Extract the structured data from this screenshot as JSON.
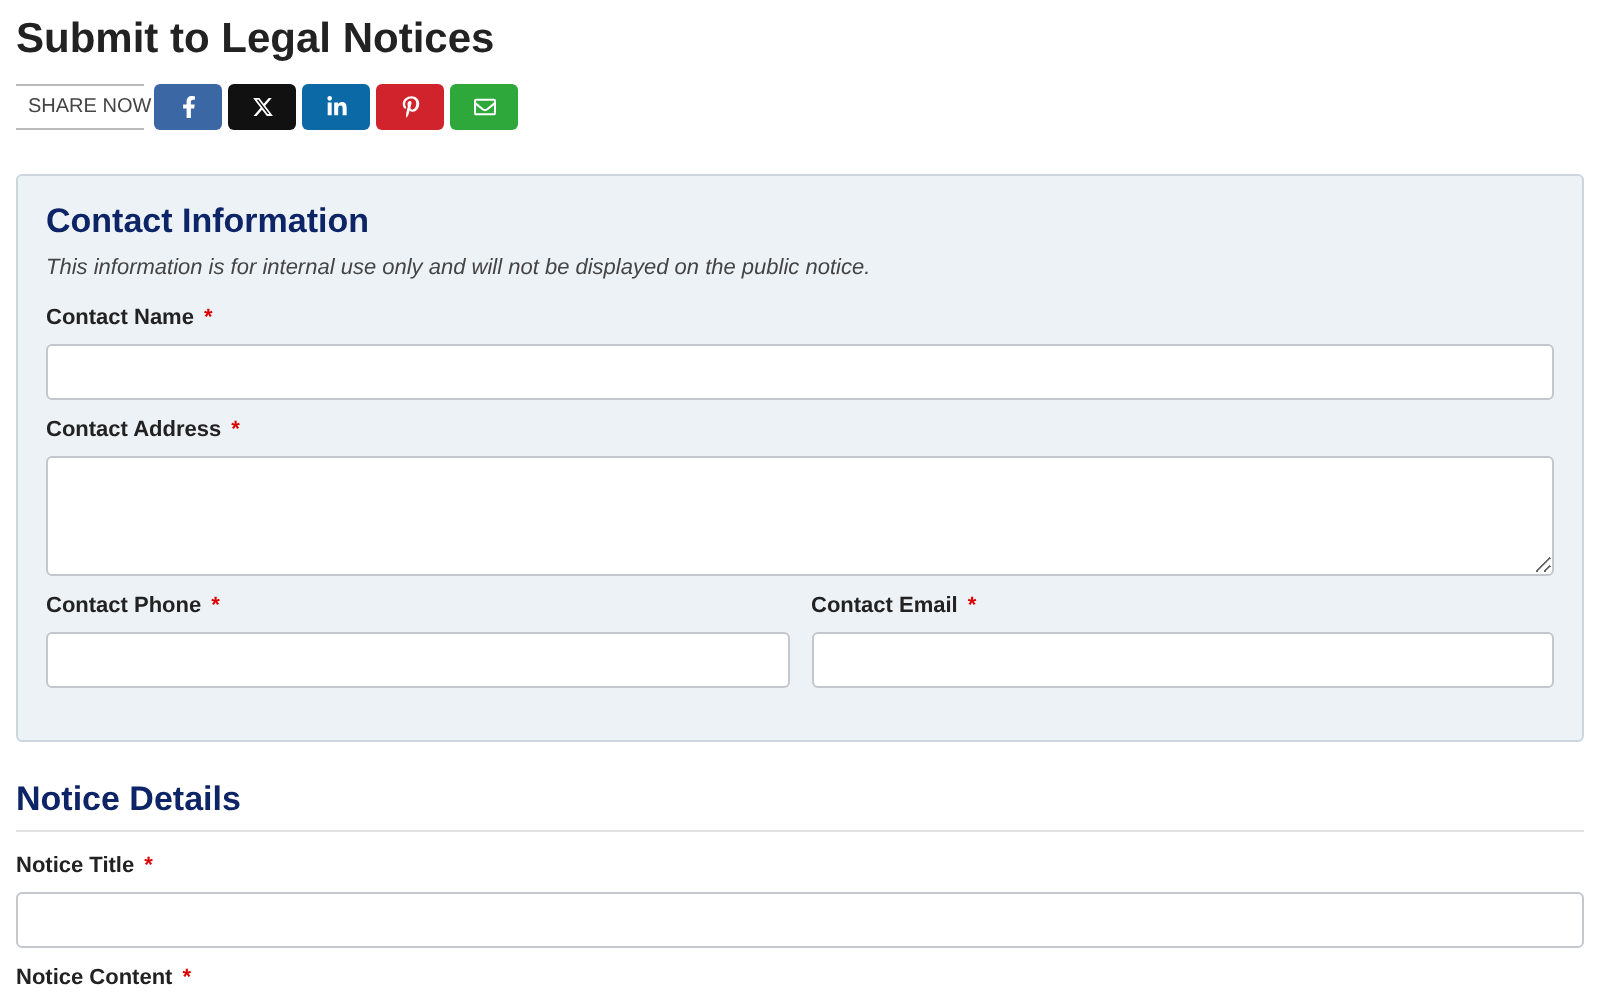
{
  "page_title": "Submit to Legal Notices",
  "share": {
    "label": "SHARE NOW",
    "buttons": [
      {
        "kind": "facebook",
        "color": "#3b67a5"
      },
      {
        "kind": "x",
        "color": "#111111"
      },
      {
        "kind": "linkedin",
        "color": "#0b6aa5"
      },
      {
        "kind": "pinterest",
        "color": "#d0232b"
      },
      {
        "kind": "email",
        "color": "#2ea83a"
      }
    ]
  },
  "contact_section": {
    "title": "Contact Information",
    "note": "This information is for internal use only and will not be displayed on the public notice.",
    "rows": [
      [
        {
          "label": "Contact Name",
          "required_mark": "*",
          "kind": "input"
        }
      ],
      [
        {
          "label": "Contact Address",
          "required_mark": "*",
          "kind": "textarea"
        }
      ],
      [
        {
          "label": "Contact Phone",
          "required_mark": "*",
          "kind": "input"
        },
        {
          "label": "Contact Email",
          "required_mark": "*",
          "kind": "input"
        }
      ]
    ]
  },
  "notice_section": {
    "title": "Notice Details",
    "fields": [
      {
        "label": "Notice Title",
        "required_mark": "*",
        "kind": "input"
      },
      {
        "label": "Notice Content",
        "required_mark": "*",
        "kind": "cut"
      }
    ]
  }
}
